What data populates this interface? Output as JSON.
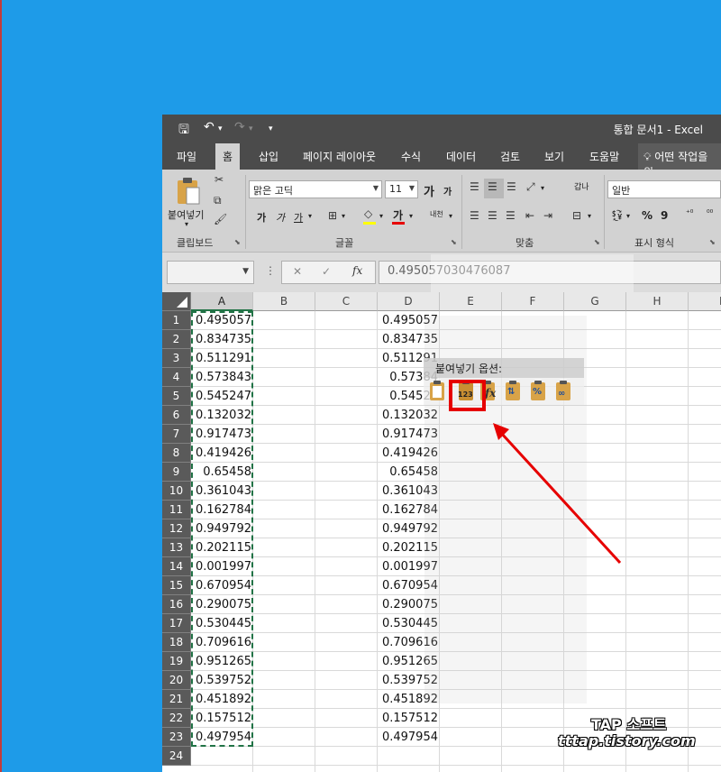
{
  "window": {
    "title": "통합 문서1 - Excel",
    "qat": {
      "save": "🖫",
      "undo": "↶",
      "redo": "↷",
      "more": "▾"
    }
  },
  "tabs": [
    "파일",
    "홈",
    "삽입",
    "페이지 레이아웃",
    "수식",
    "데이터",
    "검토",
    "보기",
    "도움말"
  ],
  "tell_me": "어떤 작업을 원",
  "ribbon": {
    "clipboard": {
      "paste_label": "붙여넣기",
      "group": "클립보드"
    },
    "font": {
      "name": "맑은 고딕",
      "size": "11",
      "bold": "가",
      "italic": "가",
      "underline": "가",
      "group": "글꼴",
      "grow": "가",
      "shrink": "가",
      "color_a": "가",
      "phonetic": "내천"
    },
    "alignment": {
      "group": "맞춤",
      "wrap": "갑나"
    },
    "number": {
      "format": "일반",
      "group": "표시 형식",
      "percent": "%",
      "comma": "9"
    }
  },
  "formula_bar": {
    "namebox": "",
    "cancel": "✕",
    "enter": "✓",
    "fx": "fx",
    "value": "0.495057030476087"
  },
  "columns": [
    "A",
    "B",
    "C",
    "D",
    "E",
    "F",
    "G",
    "H",
    "I"
  ],
  "rows": [
    "1",
    "2",
    "3",
    "4",
    "5",
    "6",
    "7",
    "8",
    "9",
    "10",
    "11",
    "12",
    "13",
    "14",
    "15",
    "16",
    "17",
    "18",
    "19",
    "20",
    "21",
    "22",
    "23",
    "24"
  ],
  "col_a": [
    "0.495057",
    "0.834735",
    "0.511291",
    "0.573843",
    "0.545247",
    "0.132032",
    "0.917473",
    "0.419426",
    "0.65458",
    "0.361043",
    "0.162784",
    "0.949792",
    "0.202115",
    "0.001997",
    "0.670954",
    "0.290075",
    "0.530445",
    "0.709616",
    "0.951265",
    "0.539752",
    "0.451892",
    "0.157512",
    "0.497954"
  ],
  "col_d": [
    "0.495057",
    "0.834735",
    "0.511291",
    "0.57384",
    "0.54524",
    "0.132032",
    "0.917473",
    "0.419426",
    "0.65458",
    "0.361043",
    "0.162784",
    "0.949792",
    "0.202115",
    "0.001997",
    "0.670954",
    "0.290075",
    "0.530445",
    "0.709616",
    "0.951265",
    "0.539752",
    "0.451892",
    "0.157512",
    "0.497954"
  ],
  "paste_options": {
    "title": "붙여넣기 옵션:",
    "buttons": [
      "paste",
      "values",
      "formulas",
      "transpose",
      "formatting",
      "paste-link"
    ],
    "values_label": "123",
    "formulas_label": "fx",
    "formatting_label": "%"
  },
  "watermark": {
    "line1": "TAP 소프트",
    "line2": "tttap.tistory.com"
  },
  "colors": {
    "accent": "#217346",
    "highlight": "#e60000",
    "desktop": "#1e9be8"
  }
}
